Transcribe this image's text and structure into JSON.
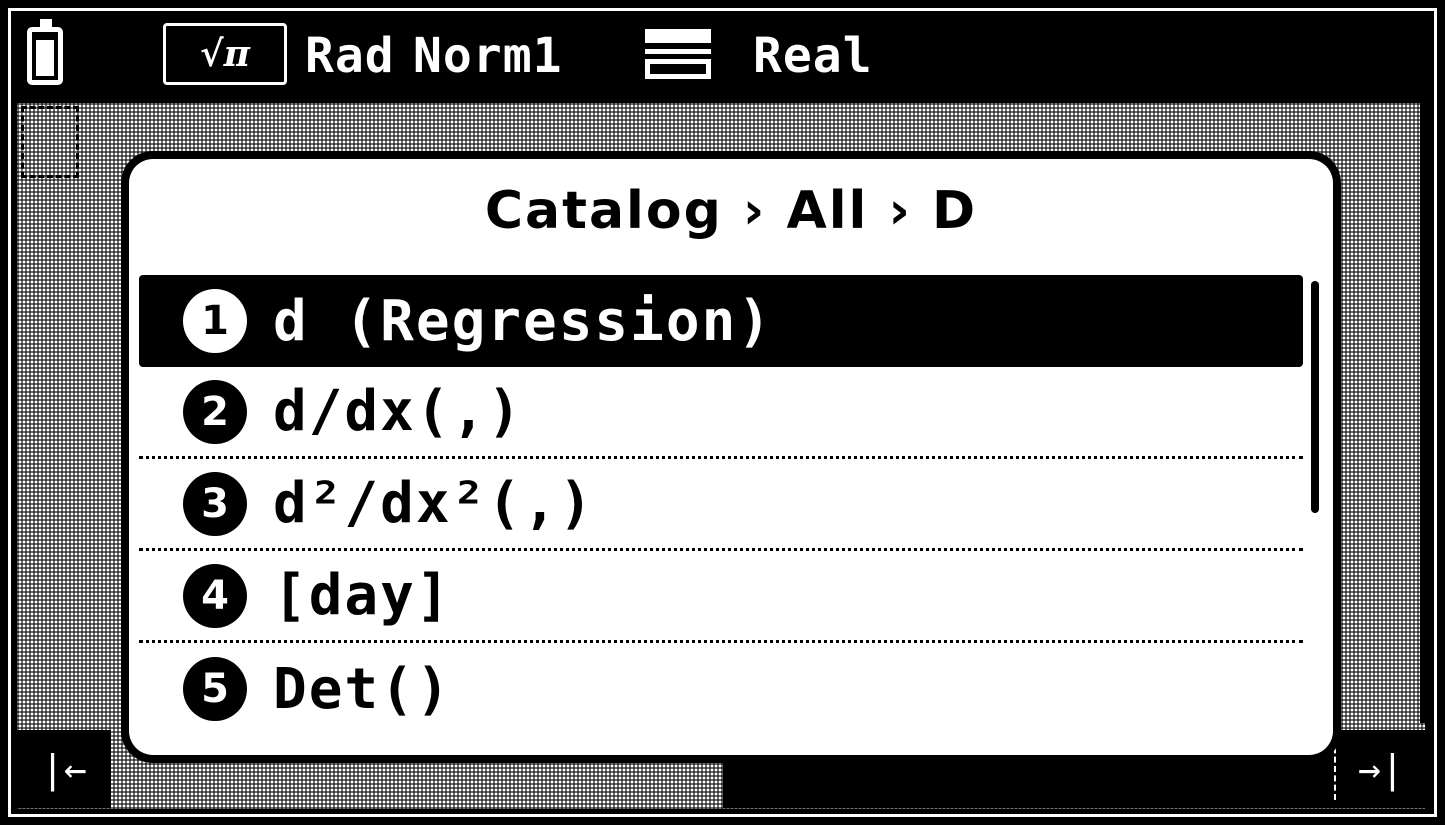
{
  "status_bar": {
    "input_mode": "√π",
    "angle_mode": "Rad",
    "display_mode": "Norm1",
    "complex_mode": "Real"
  },
  "dialog": {
    "breadcrumb": "Catalog › All › D",
    "items": [
      {
        "number": "1",
        "label": "d (Regression)",
        "selected": true
      },
      {
        "number": "2",
        "label": "d/dx(,)",
        "selected": false
      },
      {
        "number": "3",
        "label": "d²/dx²(,)",
        "selected": false
      },
      {
        "number": "4",
        "label": "[day]",
        "selected": false
      },
      {
        "number": "5",
        "label": "Det()",
        "selected": false
      }
    ]
  },
  "softkeys": {
    "left_icon": "first-page-icon",
    "right_icon": "last-page-icon"
  },
  "colors": {
    "background": "#000000",
    "foreground": "#ffffff"
  }
}
